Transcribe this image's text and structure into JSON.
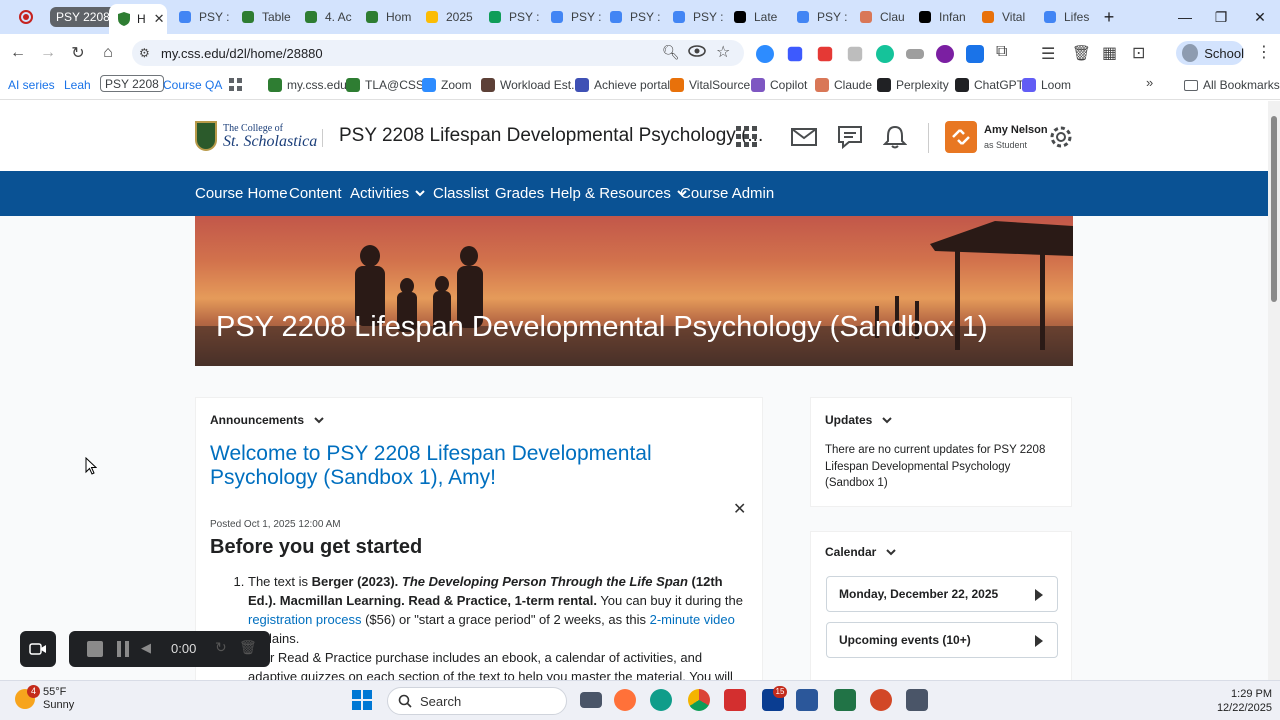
{
  "browser": {
    "tab_group_label": "PSY 2208",
    "active_tab_label": "H",
    "tabs": [
      {
        "label": "PSY :",
        "icon": "doc-icon",
        "color": "#4285f4"
      },
      {
        "label": "Table",
        "icon": "shield-icon",
        "color": "#2e7d32"
      },
      {
        "label": "4. Ac",
        "icon": "shield-icon",
        "color": "#2e7d32"
      },
      {
        "label": "Hom",
        "icon": "shield-icon",
        "color": "#2e7d32"
      },
      {
        "label": "2025",
        "icon": "drive-icon",
        "color": "#fbbc04"
      },
      {
        "label": "PSY :",
        "icon": "sheets-icon",
        "color": "#0f9d58"
      },
      {
        "label": "PSY :",
        "icon": "drive-icon",
        "color": "#4285f4"
      },
      {
        "label": "PSY :",
        "icon": "doc-icon",
        "color": "#4285f4"
      },
      {
        "label": "PSY :",
        "icon": "doc-icon",
        "color": "#4285f4"
      },
      {
        "label": "Late",
        "icon": "chatgpt-icon",
        "color": "#000000"
      },
      {
        "label": "PSY :",
        "icon": "doc-icon",
        "color": "#4285f4"
      },
      {
        "label": "Clau",
        "icon": "claude-icon",
        "color": "#d97757"
      },
      {
        "label": "Infan",
        "icon": "chatgpt-icon",
        "color": "#000000"
      },
      {
        "label": "Vital",
        "icon": "vitalsource-icon",
        "color": "#e8710a"
      },
      {
        "label": "Lifes",
        "icon": "copilot-icon",
        "color": "#4285f4"
      }
    ],
    "url": "my.css.edu/d2l/home/28880",
    "profile_label": "School"
  },
  "bookmarks": [
    {
      "label": "AI series",
      "color": "#1a73e8",
      "boxed": false,
      "noicon": true
    },
    {
      "label": "Leah",
      "color": "#1a73e8",
      "boxed": false,
      "noicon": true
    },
    {
      "label": "PSY 2208",
      "color": "#5f6368",
      "boxed": true,
      "noicon": true
    },
    {
      "label": "Course QA",
      "color": "#1a73e8",
      "boxed": false,
      "noicon": true
    },
    {
      "label": "",
      "color": "#5f6368",
      "boxed": false,
      "apps": true
    },
    {
      "label": "my.css.edu",
      "color": "#2e7d32"
    },
    {
      "label": "TLA@CSS",
      "color": "#2e7d32"
    },
    {
      "label": "Zoom",
      "color": "#2d8cff"
    },
    {
      "label": "Workload Est.",
      "color": "#5d4037"
    },
    {
      "label": "Achieve portal",
      "color": "#3f51b5"
    },
    {
      "label": "VitalSource",
      "color": "#e8710a"
    },
    {
      "label": "Copilot",
      "color": "#7e57c2"
    },
    {
      "label": "Claude",
      "color": "#d97757"
    },
    {
      "label": "Perplexity",
      "color": "#202124"
    },
    {
      "label": "ChatGPT",
      "color": "#202124"
    },
    {
      "label": "Loom",
      "color": "#625df5"
    }
  ],
  "all_bookmarks_label": "All Bookmarks",
  "d2l": {
    "logo_line1": "The College of",
    "logo_line2": "St. Scholastica",
    "course_title": "PSY 2208 Lifespan Developmental Psychology (...",
    "user_name": "Amy Nelson",
    "user_role": "as Student",
    "nav": [
      {
        "label": "Course Home",
        "dropdown": false
      },
      {
        "label": "Content",
        "dropdown": false
      },
      {
        "label": "Activities",
        "dropdown": true
      },
      {
        "label": "Classlist",
        "dropdown": false
      },
      {
        "label": "Grades",
        "dropdown": false
      },
      {
        "label": "Help & Resources",
        "dropdown": true
      },
      {
        "label": "Course Admin",
        "dropdown": false
      }
    ],
    "banner_title": "PSY 2208 Lifespan Developmental Psychology (Sandbox 1)"
  },
  "announcements": {
    "title": "Announcements",
    "welcome": "Welcome to PSY 2208 Lifespan Developmental Psychology (Sandbox 1), Amy!",
    "posted": "Posted Oct 1, 2025 12:00 AM",
    "heading": "Before you get started",
    "item1": {
      "t1": "The text is ",
      "b1": "Berger (2023). ",
      "bi": "The Developing Person Through the Life Span",
      "b2": " (12th Ed.). Macmillan Learning. Read & Practice, 1-term rental.",
      "t2": " You can buy it during the ",
      "link1": "registration process",
      "t3": " ($56) or \"start a grace period\" of 2 weeks, as this ",
      "link2": "2-minute video",
      "t4": " explains."
    },
    "item2": "Your Read & Practice purchase includes an ebook, a calendar of activities, and adaptive quizzes on each section of the text to help you master the material. You will access"
  },
  "updates": {
    "title": "Updates",
    "text": "There are no current updates for PSY 2208 Lifespan Developmental Psychology (Sandbox 1)"
  },
  "calendar": {
    "title": "Calendar",
    "date": "Monday, December 22, 2025",
    "upcoming": "Upcoming events (10+)"
  },
  "recorder": {
    "time": "0:00"
  },
  "taskbar": {
    "temp": "55°F",
    "weather": "Sunny",
    "weather_badge": "4",
    "search": "Search",
    "mail_badge": "15",
    "time": "1:29 PM",
    "date": "12/22/2025"
  },
  "colors": {
    "nav": "#0a5294",
    "link": "#006fbf",
    "accent": "#e87722"
  }
}
